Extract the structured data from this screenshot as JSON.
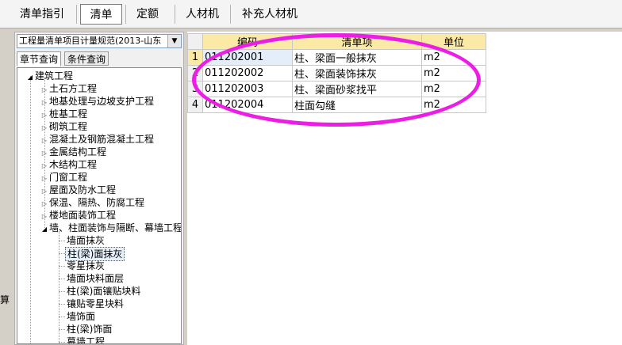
{
  "topbar": {
    "tabs": [
      {
        "label": "清单指引"
      },
      {
        "label": "清单"
      },
      {
        "label": "定额"
      },
      {
        "label": "人材机"
      },
      {
        "label": "补充人材机"
      }
    ]
  },
  "left": {
    "combo_value": "工程量清单项目计量规范(2013-山东",
    "subtabs": [
      "章节查询",
      "条件查询"
    ],
    "tree": {
      "root": "建筑工程",
      "items": [
        "土石方工程",
        "地基处理与边坡支护工程",
        "桩基工程",
        "砌筑工程",
        "混凝土及钢筋混凝土工程",
        "金属结构工程",
        "木结构工程",
        "门窗工程",
        "屋面及防水工程",
        "保温、隔热、防腐工程",
        "楼地面装饰工程",
        "墙、柱面装饰与隔断、幕墙工程"
      ],
      "children": [
        "墙面抹灰",
        "柱(梁)面抹灰",
        "零星抹灰",
        "墙面块料面层",
        "柱(梁)面镶贴块料",
        "镶贴零星块料",
        "墙饰面",
        "柱(梁)饰面",
        "幕墙工程"
      ]
    }
  },
  "grid": {
    "headers": [
      "编码",
      "清单项",
      "单位"
    ],
    "rows": [
      {
        "n": "1",
        "code": "011202001",
        "name": "柱、梁面一般抹灰",
        "unit": "m2"
      },
      {
        "n": "2",
        "code": "011202002",
        "name": "柱、梁面装饰抹灰",
        "unit": "m2"
      },
      {
        "n": "3",
        "code": "011202003",
        "name": "柱、梁面砂浆找平",
        "unit": "m2"
      },
      {
        "n": "4",
        "code": "011202004",
        "name": "柱面勾缝",
        "unit": "m2"
      }
    ]
  },
  "stray": {
    "a": "算"
  },
  "colors": {
    "highlight": "#ec1ee6",
    "header_bg": "#fbe9a6"
  }
}
